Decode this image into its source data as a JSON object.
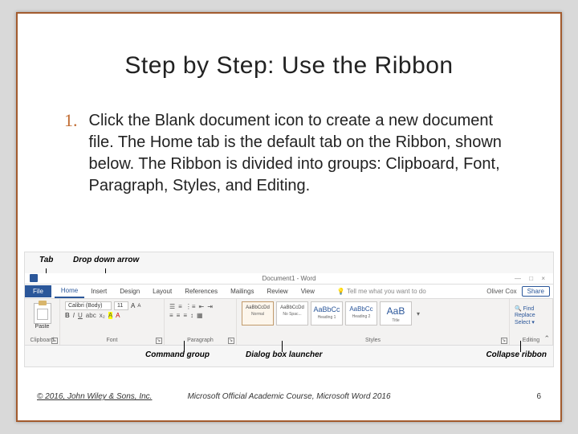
{
  "title": "Step by Step: Use the Ribbon",
  "list_number": "1.",
  "body_text": "Click the Blank document icon to create a new document file. The Home tab is the default tab on the Ribbon, shown below. The Ribbon is divided into groups: Clipboard, Font, Paragraph, Styles, and Editing.",
  "callouts": {
    "top_tab": "Tab",
    "top_dropdown": "Drop down arrow",
    "bottom_group": "Command group",
    "bottom_launcher": "Dialog box launcher",
    "bottom_collapse": "Collapse ribbon"
  },
  "ribbon": {
    "doc_title": "Document1 - Word",
    "tell_me": "Tell me what you want to do",
    "user": "Oliver Cox",
    "share": "Share",
    "tabs": [
      "File",
      "Home",
      "Insert",
      "Design",
      "Layout",
      "References",
      "Mailings",
      "Review",
      "View"
    ],
    "groups": {
      "clipboard": {
        "label": "Clipboard",
        "paste": "Paste"
      },
      "font": {
        "label": "Font",
        "name": "Calibri (Body)",
        "size": "11"
      },
      "paragraph": {
        "label": "Paragraph"
      },
      "styles": {
        "label": "Styles",
        "items": [
          {
            "sample": "AaBbCcDd",
            "name": "Normal"
          },
          {
            "sample": "AaBbCcDd",
            "name": "No Spac..."
          },
          {
            "sample": "AaBbCc",
            "name": "Heading 1"
          },
          {
            "sample": "AaBbCc",
            "name": "Heading 2"
          },
          {
            "sample": "AaB",
            "name": "Title"
          }
        ]
      },
      "editing": {
        "label": "Editing",
        "find": "Find",
        "replace": "Replace",
        "select": "Select"
      }
    }
  },
  "footer": {
    "copyright": "© 2016, John Wiley & Sons, Inc.",
    "course": "Microsoft Official Academic Course, Microsoft Word 2016",
    "page": "6"
  }
}
